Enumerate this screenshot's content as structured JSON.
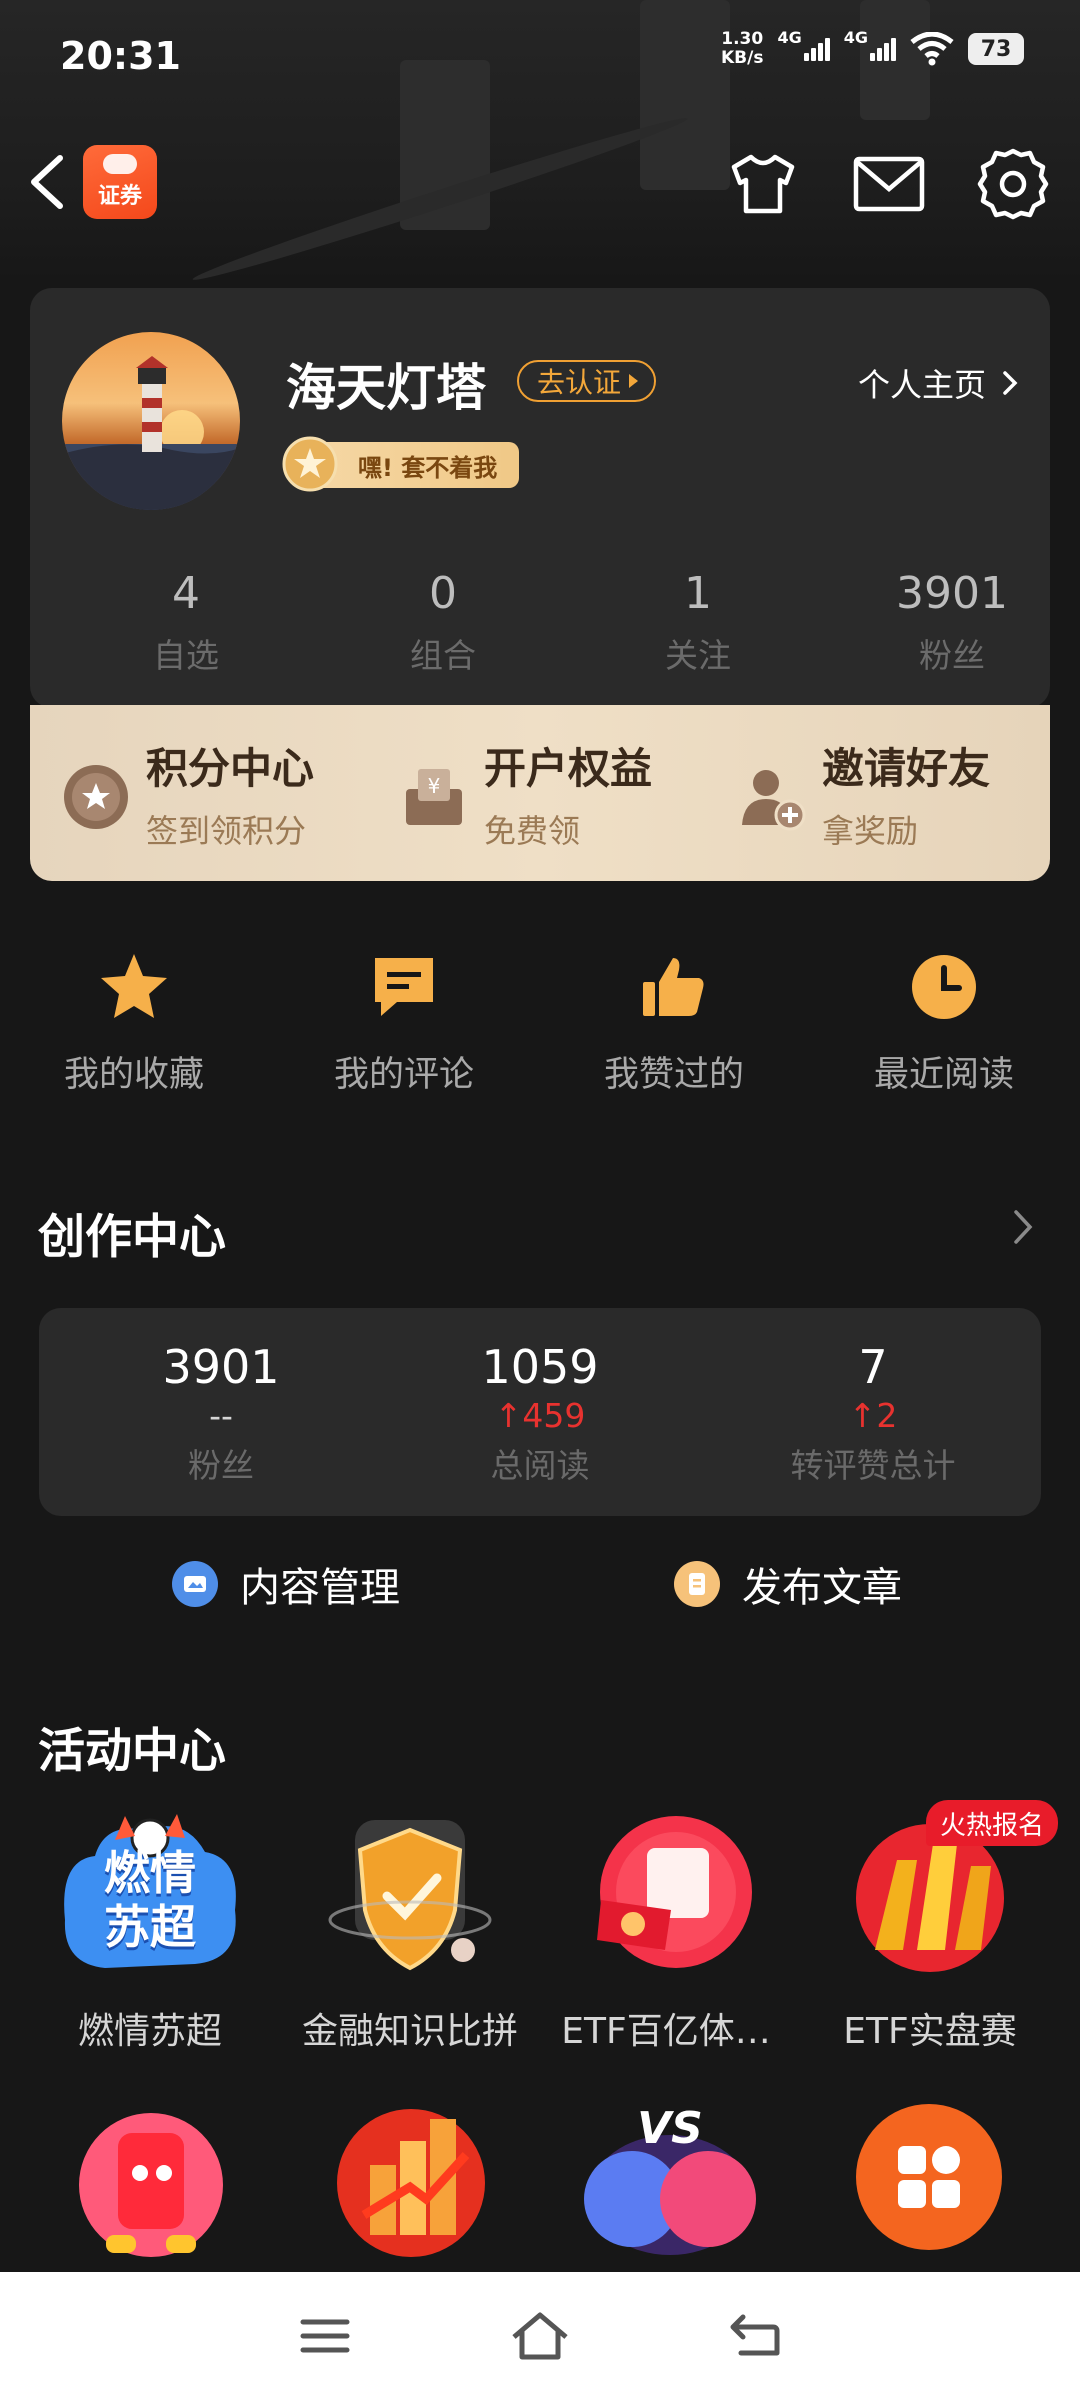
{
  "status": {
    "time": "20:31",
    "speed": "1.30",
    "speed_unit": "KB/s",
    "net1": "4G",
    "net2": "4G",
    "battery": "73"
  },
  "header": {
    "brand_label": "证券"
  },
  "profile": {
    "name": "海天灯塔",
    "verify_label": "去认证",
    "homepage_label": "个人主页",
    "badge_text": "嘿! 套不着我",
    "stats": [
      {
        "value": "4",
        "label": "自选"
      },
      {
        "value": "0",
        "label": "组合"
      },
      {
        "value": "1",
        "label": "关注"
      },
      {
        "value": "3901",
        "label": "粉丝"
      }
    ]
  },
  "benefits": [
    {
      "title": "积分中心",
      "sub": "签到领积分"
    },
    {
      "title": "开户权益",
      "sub": "免费领"
    },
    {
      "title": "邀请好友",
      "sub": "拿奖励"
    }
  ],
  "quick_actions": [
    {
      "label": "我的收藏"
    },
    {
      "label": "我的评论"
    },
    {
      "label": "我赞过的"
    },
    {
      "label": "最近阅读"
    }
  ],
  "creator": {
    "title": "创作中心",
    "stats": [
      {
        "value": "3901",
        "change": "--",
        "label": "粉丝"
      },
      {
        "value": "1059",
        "change": "↑459",
        "label": "总阅读"
      },
      {
        "value": "7",
        "change": "↑2",
        "label": "转评赞总计"
      }
    ],
    "content_manage": "内容管理",
    "publish": "发布文章"
  },
  "activity": {
    "title": "活动中心",
    "hot_tag": "火热报名",
    "items": [
      {
        "label": "燃情苏超",
        "art": "燃情\n苏超"
      },
      {
        "label": "金融知识比拼"
      },
      {
        "label": "ETF百亿体…"
      },
      {
        "label": "ETF实盘赛"
      }
    ],
    "row2_art": "VS"
  },
  "colors": {
    "accent": "#f3a73a",
    "brand": "#f4481b",
    "up_red": "#e8322f",
    "background": "#171717",
    "card": "#2a2a2a"
  }
}
